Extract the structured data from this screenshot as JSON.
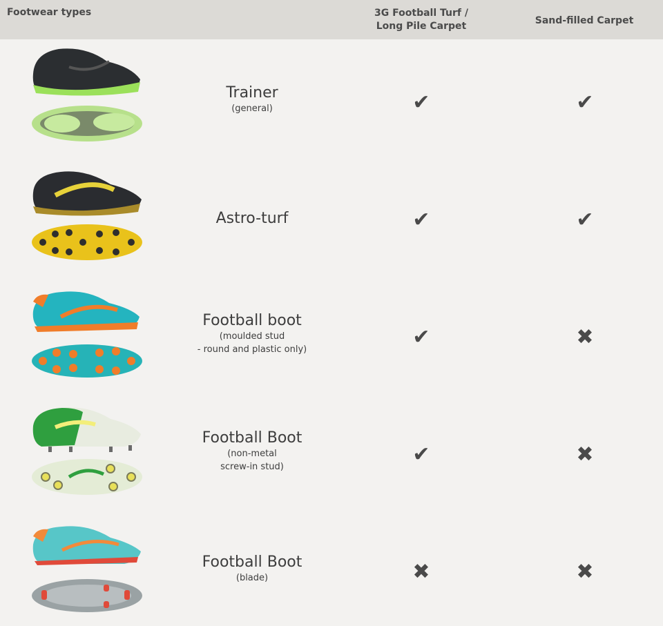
{
  "header": {
    "col_footwear": "Footwear types",
    "col_3g": "3G Football Turf / Long Pile Carpet",
    "col_sand": "Sand-filled Carpet"
  },
  "rows": [
    {
      "name": "Trainer",
      "sub": "(general)",
      "sub2": "",
      "mark_3g": "✔",
      "mark_sand": "✔",
      "shoe_colors": {
        "upper": "#2b2e31",
        "sole": "#b7e08b",
        "accent": "#9be05a"
      }
    },
    {
      "name": "Astro-turf",
      "sub": "",
      "sub2": "",
      "mark_3g": "✔",
      "mark_sand": "✔",
      "shoe_colors": {
        "upper": "#2a2c30",
        "sole": "#e9c21b",
        "accent": "#e7d23a"
      }
    },
    {
      "name": "Football boot",
      "sub": "(moulded stud",
      "sub2": "- round and plastic only)",
      "mark_3g": "✔",
      "mark_sand": "✖",
      "shoe_colors": {
        "upper": "#24b4bf",
        "sole": "#26b3b7",
        "accent": "#f07d2a"
      }
    },
    {
      "name": "Football Boot",
      "sub": "(non-metal",
      "sub2": "screw-in stud)",
      "mark_3g": "✔",
      "mark_sand": "✖",
      "shoe_colors": {
        "upper": "#2f9f3f",
        "sole": "#e4ecd6",
        "accent": "#f3ee7a"
      }
    },
    {
      "name": "Football Boot",
      "sub": "(blade)",
      "sub2": "",
      "mark_3g": "✖",
      "mark_sand": "✖",
      "shoe_colors": {
        "upper": "#57c6c8",
        "sole": "#9aa2a4",
        "accent": "#f28a3a"
      }
    }
  ]
}
